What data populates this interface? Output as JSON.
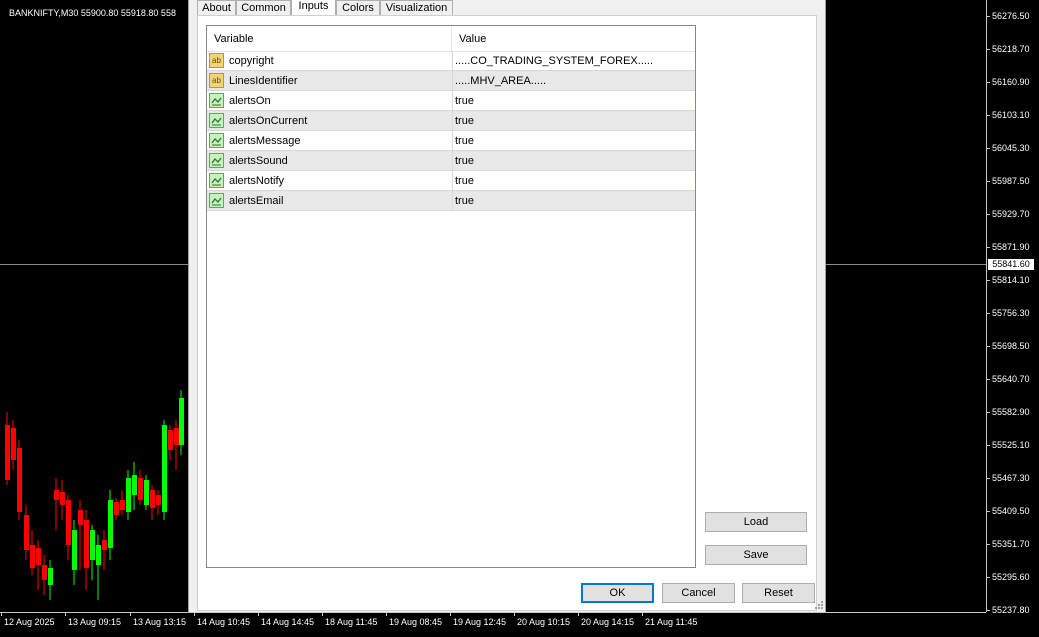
{
  "chart": {
    "title": "BANKNIFTY,M30  55900.80 55918.80 558",
    "current_price": "55841.60",
    "price_labels": [
      "56276.50",
      "56218.70",
      "56160.90",
      "56103.10",
      "56045.30",
      "55987.50",
      "55929.70",
      "55871.90",
      "55814.10",
      "55756.30",
      "55698.50",
      "55640.70",
      "55582.90",
      "55525.10",
      "55467.30",
      "55409.50",
      "55351.70",
      "55295.60",
      "55237.80"
    ],
    "time_labels": [
      "12 Aug 2025",
      "13 Aug 09:15",
      "13 Aug 13:15",
      "14 Aug 10:45",
      "14 Aug 14:45",
      "18 Aug 11:45",
      "19 Aug 08:45",
      "19 Aug 12:45",
      "20 Aug 10:15",
      "20 Aug 14:15",
      "21 Aug 11:45"
    ],
    "colors": {
      "background": "#000000",
      "bull": "#00ff00",
      "bear": "#ff0000",
      "text": "#ffffff"
    }
  },
  "dialog": {
    "tabs": [
      {
        "label": "About",
        "active": false
      },
      {
        "label": "Common",
        "active": false
      },
      {
        "label": "Inputs",
        "active": true
      },
      {
        "label": "Colors",
        "active": false
      },
      {
        "label": "Visualization",
        "active": false
      }
    ],
    "table": {
      "headers": {
        "variable": "Variable",
        "value": "Value"
      },
      "rows": [
        {
          "icon": "text-icon",
          "variable": "copyright",
          "value": ".....CO_TRADING_SYSTEM_FOREX....."
        },
        {
          "icon": "text-icon",
          "variable": "LinesIdentifier",
          "value": ".....MHV_AREA....."
        },
        {
          "icon": "bool-icon",
          "variable": "alertsOn",
          "value": "true"
        },
        {
          "icon": "bool-icon",
          "variable": "alertsOnCurrent",
          "value": "true"
        },
        {
          "icon": "bool-icon",
          "variable": "alertsMessage",
          "value": "true"
        },
        {
          "icon": "bool-icon",
          "variable": "alertsSound",
          "value": "true"
        },
        {
          "icon": "bool-icon",
          "variable": "alertsNotify",
          "value": "true"
        },
        {
          "icon": "bool-icon",
          "variable": "alertsEmail",
          "value": "true"
        }
      ],
      "text_icon_glyph": "ab"
    },
    "buttons": {
      "load": "Load",
      "save": "Save",
      "ok": "OK",
      "cancel": "Cancel",
      "reset": "Reset"
    }
  }
}
